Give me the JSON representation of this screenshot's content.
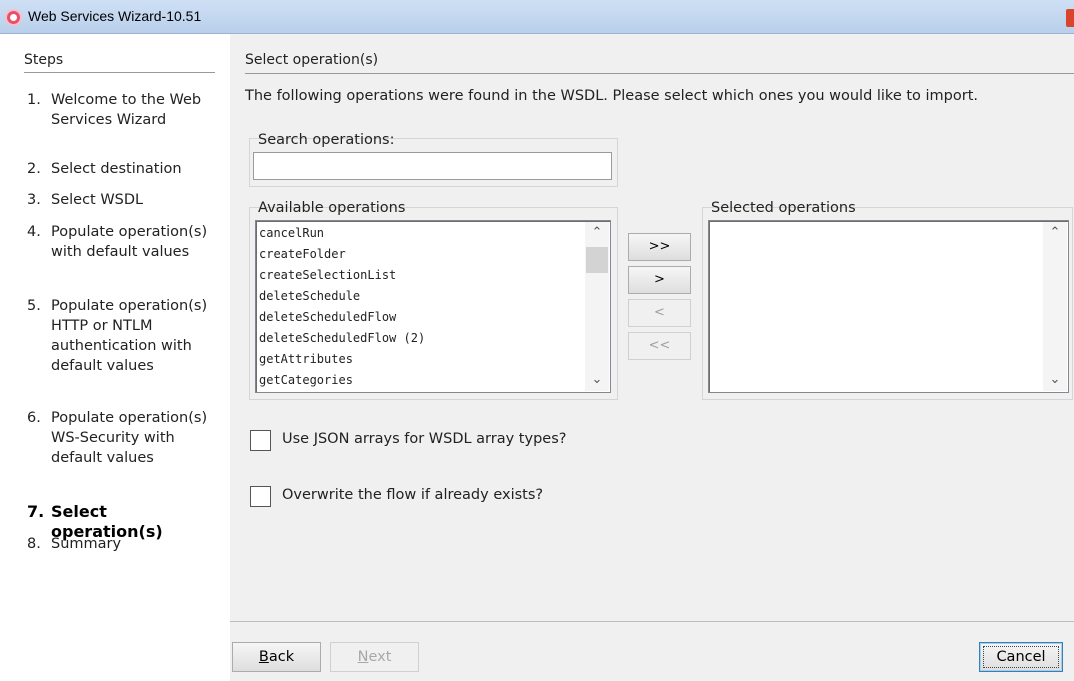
{
  "window": {
    "title": "Web Services Wizard-10.51"
  },
  "steps": {
    "heading": "Steps",
    "items": [
      {
        "num": "1.",
        "text": "Welcome to the Web Services Wizard"
      },
      {
        "num": "2.",
        "text": "Select destination"
      },
      {
        "num": "3.",
        "text": "Select WSDL"
      },
      {
        "num": "4.",
        "text": "Populate operation(s) with default values"
      },
      {
        "num": "5.",
        "text": "Populate operation(s) HTTP or NTLM authentication with default values"
      },
      {
        "num": "6.",
        "text": "Populate operation(s) WS-Security with default values"
      },
      {
        "num": "7.",
        "text": "Select operation(s)",
        "active": true
      },
      {
        "num": "8.",
        "text": "Summary"
      }
    ]
  },
  "main": {
    "title": "Select operation(s)",
    "description": "The following operations were found in the WSDL. Please select which ones you would like to import.",
    "search": {
      "label": "Search operations:",
      "value": ""
    },
    "available": {
      "label": "Available operations",
      "items": [
        "cancelRun",
        "createFolder",
        "createSelectionList",
        "deleteSchedule",
        "deleteScheduledFlow",
        "deleteScheduledFlow (2)",
        "getAttributes",
        "getCategories"
      ]
    },
    "selected": {
      "label": "Selected operations",
      "items": []
    },
    "transfer": {
      "add_all": ">>",
      "add": ">",
      "remove": "<",
      "remove_all": "<<"
    },
    "options": {
      "json_arrays": {
        "label": "Use JSON arrays for WSDL array types?",
        "checked": false
      },
      "overwrite": {
        "label": "Overwrite the flow if already exists?",
        "checked": false
      }
    }
  },
  "footer": {
    "back": {
      "mnemonic": "B",
      "rest": "ack"
    },
    "next": {
      "mnemonic": "N",
      "rest": "ext"
    },
    "cancel": "Cancel"
  }
}
